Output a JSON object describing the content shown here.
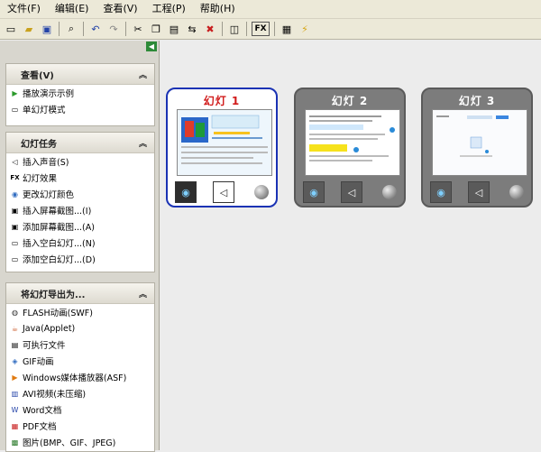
{
  "menu": [
    "文件(F)",
    "编辑(E)",
    "查看(V)",
    "工程(P)",
    "帮助(H)"
  ],
  "toolbar_icons": [
    "new-icon",
    "open-icon",
    "save-icon",
    "preview-icon",
    "undo-icon",
    "redo-icon",
    "cut-icon",
    "copy-icon",
    "paste-icon",
    "delete-icon",
    "capture-icon",
    "fx-icon",
    "effects-icon",
    "publish-icon"
  ],
  "toolbar_fx": "FX",
  "view_panel": {
    "title": "查看(V)",
    "items": [
      {
        "label": "播放演示示例",
        "icon": "play-icon"
      },
      {
        "label": "单幻灯模式",
        "icon": "single-slide-icon"
      }
    ]
  },
  "slide_tasks": {
    "title": "幻灯任务",
    "items": [
      {
        "label": "插入声音(S)",
        "icon": "sound-icon"
      },
      {
        "label": "幻灯效果",
        "icon": "fx-icon"
      },
      {
        "label": "更改幻灯颜色",
        "icon": "color-icon"
      },
      {
        "label": "插入屏幕截图...(I)",
        "icon": "insert-screenshot-icon"
      },
      {
        "label": "添加屏幕截图...(A)",
        "icon": "add-screenshot-icon"
      },
      {
        "label": "插入空白幻灯...(N)",
        "icon": "insert-blank-icon"
      },
      {
        "label": "添加空白幻灯...(D)",
        "icon": "add-blank-icon"
      }
    ]
  },
  "export_panel": {
    "title": "将幻灯导出为...",
    "items": [
      {
        "label": "FLASH动画(SWF)",
        "icon": "flash-icon"
      },
      {
        "label": "Java(Applet)",
        "icon": "java-icon"
      },
      {
        "label": "可执行文件",
        "icon": "exe-icon"
      },
      {
        "label": "GIF动画",
        "icon": "gif-icon"
      },
      {
        "label": "Windows媒体播放器(ASF)",
        "icon": "wmp-icon"
      },
      {
        "label": "AVI视频(未压缩)",
        "icon": "avi-icon"
      },
      {
        "label": "Word文档",
        "icon": "word-icon"
      },
      {
        "label": "PDF文档",
        "icon": "pdf-icon"
      },
      {
        "label": "图片(BMP、GIF、JPEG)",
        "icon": "image-icon"
      }
    ]
  },
  "slides": [
    {
      "title": "幻灯 1",
      "selected": true
    },
    {
      "title": "幻灯 2",
      "selected": false
    },
    {
      "title": "幻灯 3",
      "selected": false
    }
  ],
  "colors": {
    "selected_border": "#1a32b4",
    "selected_title": "#d11b1b",
    "slide_bg": "#7c7c7c",
    "content_bg": "#ececec"
  }
}
